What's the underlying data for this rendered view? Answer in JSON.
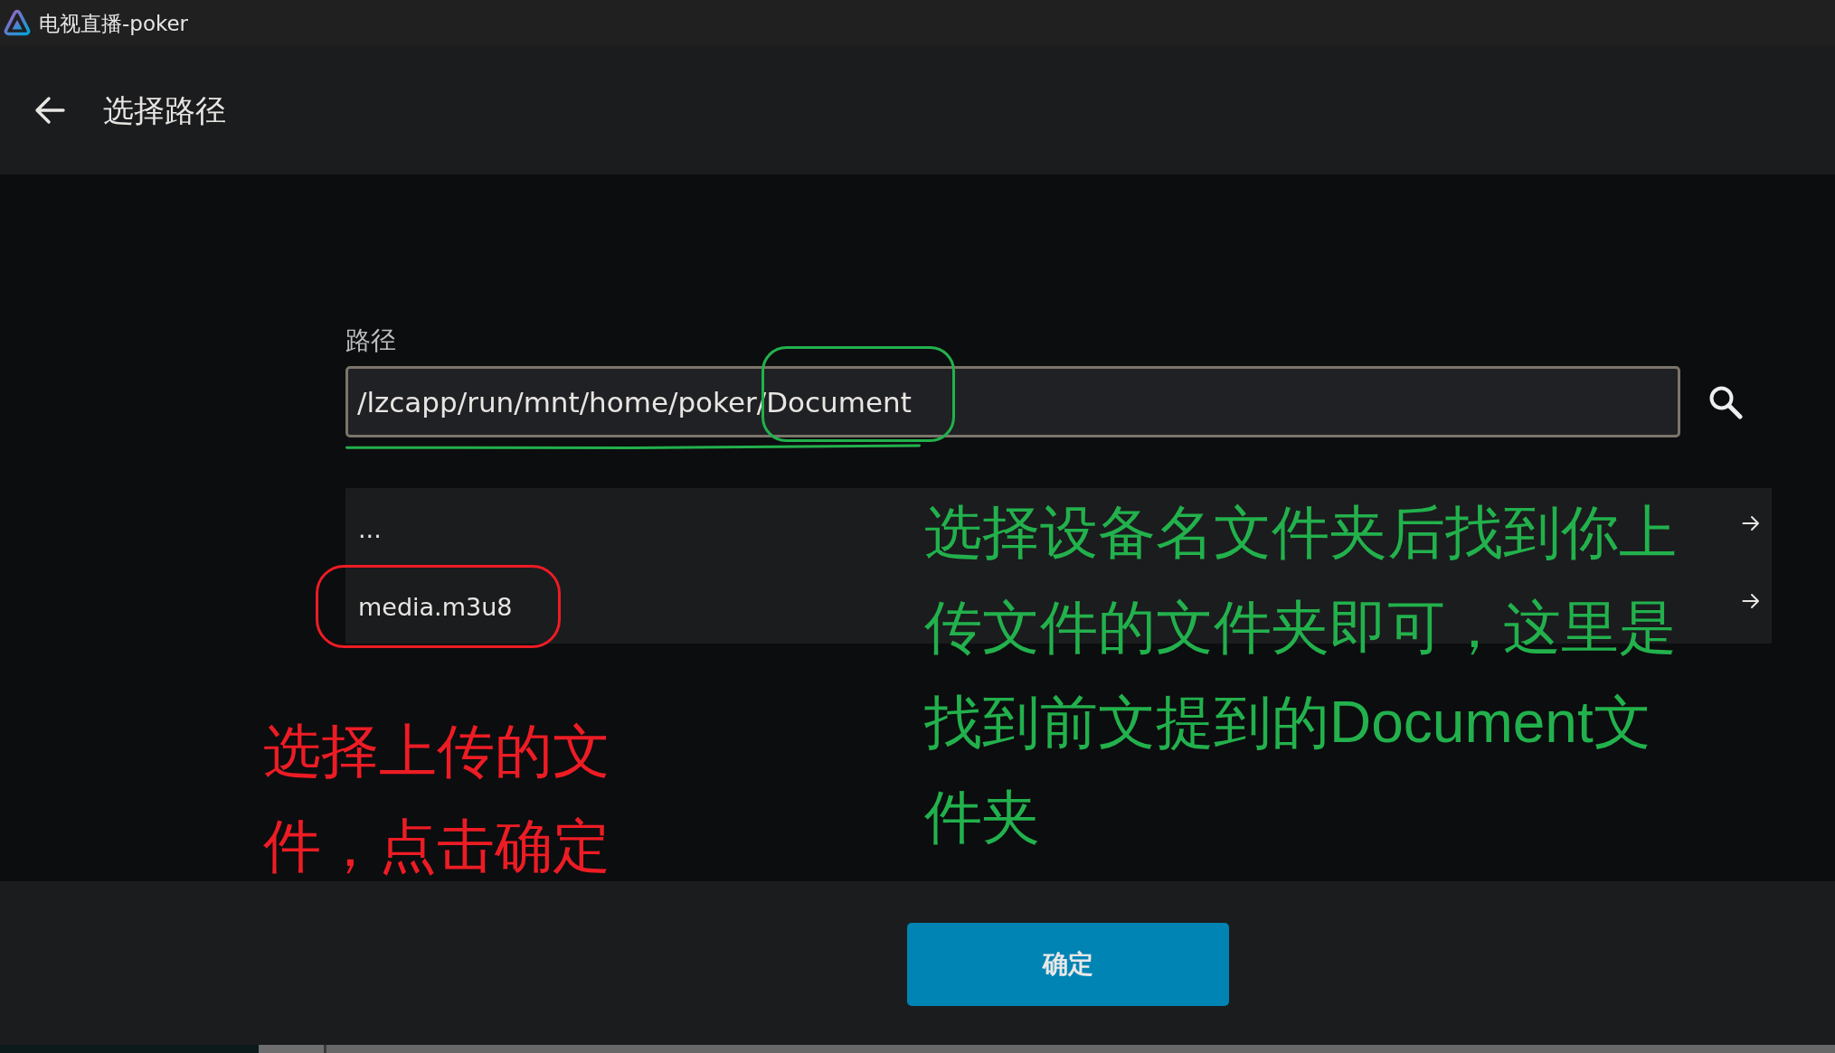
{
  "window": {
    "title": "电视直播-poker"
  },
  "header": {
    "title": "选择路径"
  },
  "path_field": {
    "label": "路径",
    "value": "/lzcapp/run/mnt/home/poker/Document"
  },
  "entries": [
    {
      "name": "..."
    },
    {
      "name": "media.m3u8"
    }
  ],
  "annotations": [
    {
      "text": "选择设备名文件夹后找到你上传文件的文件夹即可，这里是找到前文提到的Document文件夹",
      "color": "#22b14c"
    },
    {
      "text": "选择上传的文件，点击确定",
      "color": "#ed1c24"
    }
  ],
  "buttons": [
    {
      "label": "确定"
    }
  ]
}
